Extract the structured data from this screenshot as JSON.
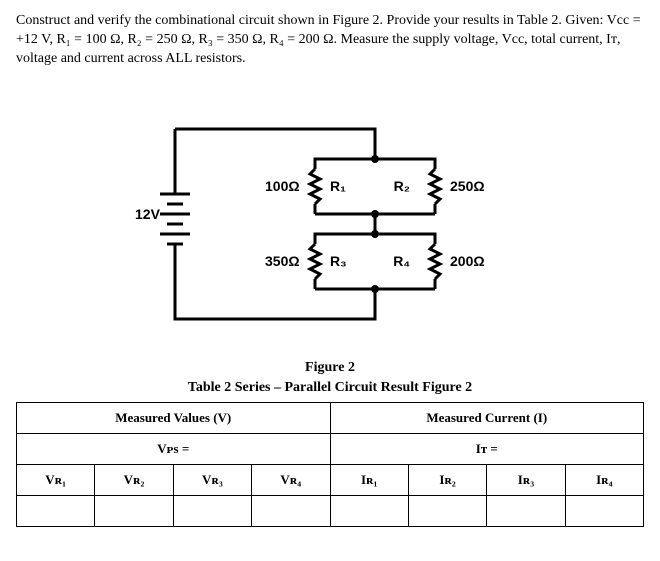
{
  "instructions": "Construct and verify the combinational circuit shown in Figure 2. Provide your results in Table 2. Given: Vcc = +12 V, R₁ = 100 Ω, R₂ = 250 Ω, R₃ = 350 Ω, R₄ = 200 Ω. Measure the supply voltage, Vcc, total current, Iᴛ, voltage and current across ALL resistors.",
  "circuit": {
    "source_label": "12V",
    "r1_val": "100Ω",
    "r1_name": "R₁",
    "r2_val": "250Ω",
    "r2_name": "R₂",
    "r3_val": "350Ω",
    "r3_name": "R₃",
    "r4_val": "200Ω",
    "r4_name": "R₄"
  },
  "figure_caption": "Figure 2",
  "table_caption": "Table 2 Series – Parallel Circuit Result Figure 2",
  "table": {
    "voltage_header": "Measured Values (V)",
    "current_header": "Measured Current (I)",
    "vps_label": "Vᴘs =",
    "it_label": "Iᴛ =",
    "v_cols": [
      "Vʀ₁",
      "Vʀ₂",
      "Vʀ₃",
      "Vʀ₄"
    ],
    "i_cols": [
      "Iʀ₁",
      "Iʀ₂",
      "Iʀ₃",
      "Iʀ₄"
    ]
  }
}
